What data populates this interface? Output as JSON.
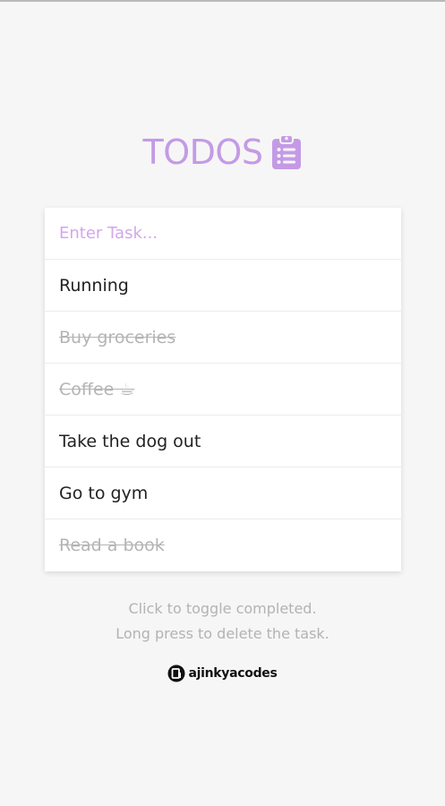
{
  "app": {
    "title": "TODOS",
    "title_icon": "clipboard-list-icon",
    "accent_color": "#c49ae6"
  },
  "input": {
    "placeholder": "Enter Task...",
    "value": ""
  },
  "tasks": [
    {
      "label": "Running",
      "completed": false
    },
    {
      "label": "Buy groceries",
      "completed": true
    },
    {
      "label": "Coffee ☕",
      "completed": true
    },
    {
      "label": "Take the dog out",
      "completed": false
    },
    {
      "label": "Go to gym",
      "completed": false
    },
    {
      "label": "Read a book",
      "completed": true
    }
  ],
  "hints": {
    "line1": "Click to toggle completed.",
    "line2": "Long press to delete the task."
  },
  "brand": {
    "name": "ajinkyacodes",
    "icon": "ajinkyacodes-logo-icon"
  }
}
